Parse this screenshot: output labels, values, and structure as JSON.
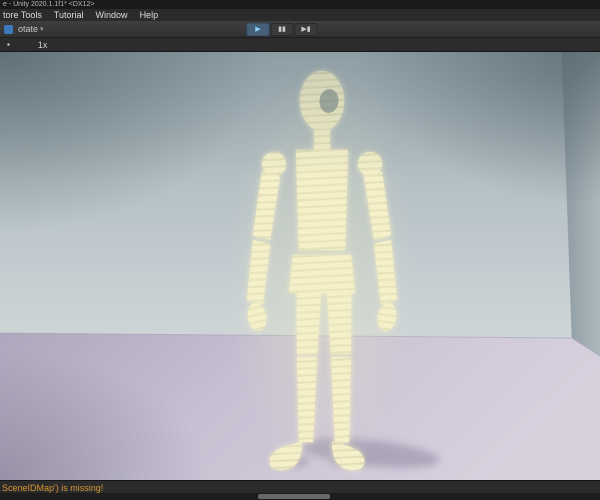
{
  "window": {
    "title": "e - Unity 2020.1.1f1* <DX12>"
  },
  "menu_bar": {
    "items": [
      "tore Tools",
      "Tutorial",
      "Window",
      "Help"
    ]
  },
  "toolbar": {
    "rotate_label": "otate"
  },
  "icons": {
    "play": "▶",
    "pause": "▮▮",
    "step": "▶▮",
    "caret_down": "▾",
    "display": "▪"
  },
  "game_toolbar": {
    "scale_label": "1x"
  },
  "status_bar": {
    "message": "SceneIDMap') is missing!"
  },
  "colors": {
    "band_glow": "#f6f0ca",
    "wall": "#bfc9cd",
    "floor": "#c6c0d2",
    "shadow": "#9089a3",
    "status_warning": "#d79633",
    "play_active_bg": "#46607a",
    "accent_blue": "#3a79bd"
  }
}
